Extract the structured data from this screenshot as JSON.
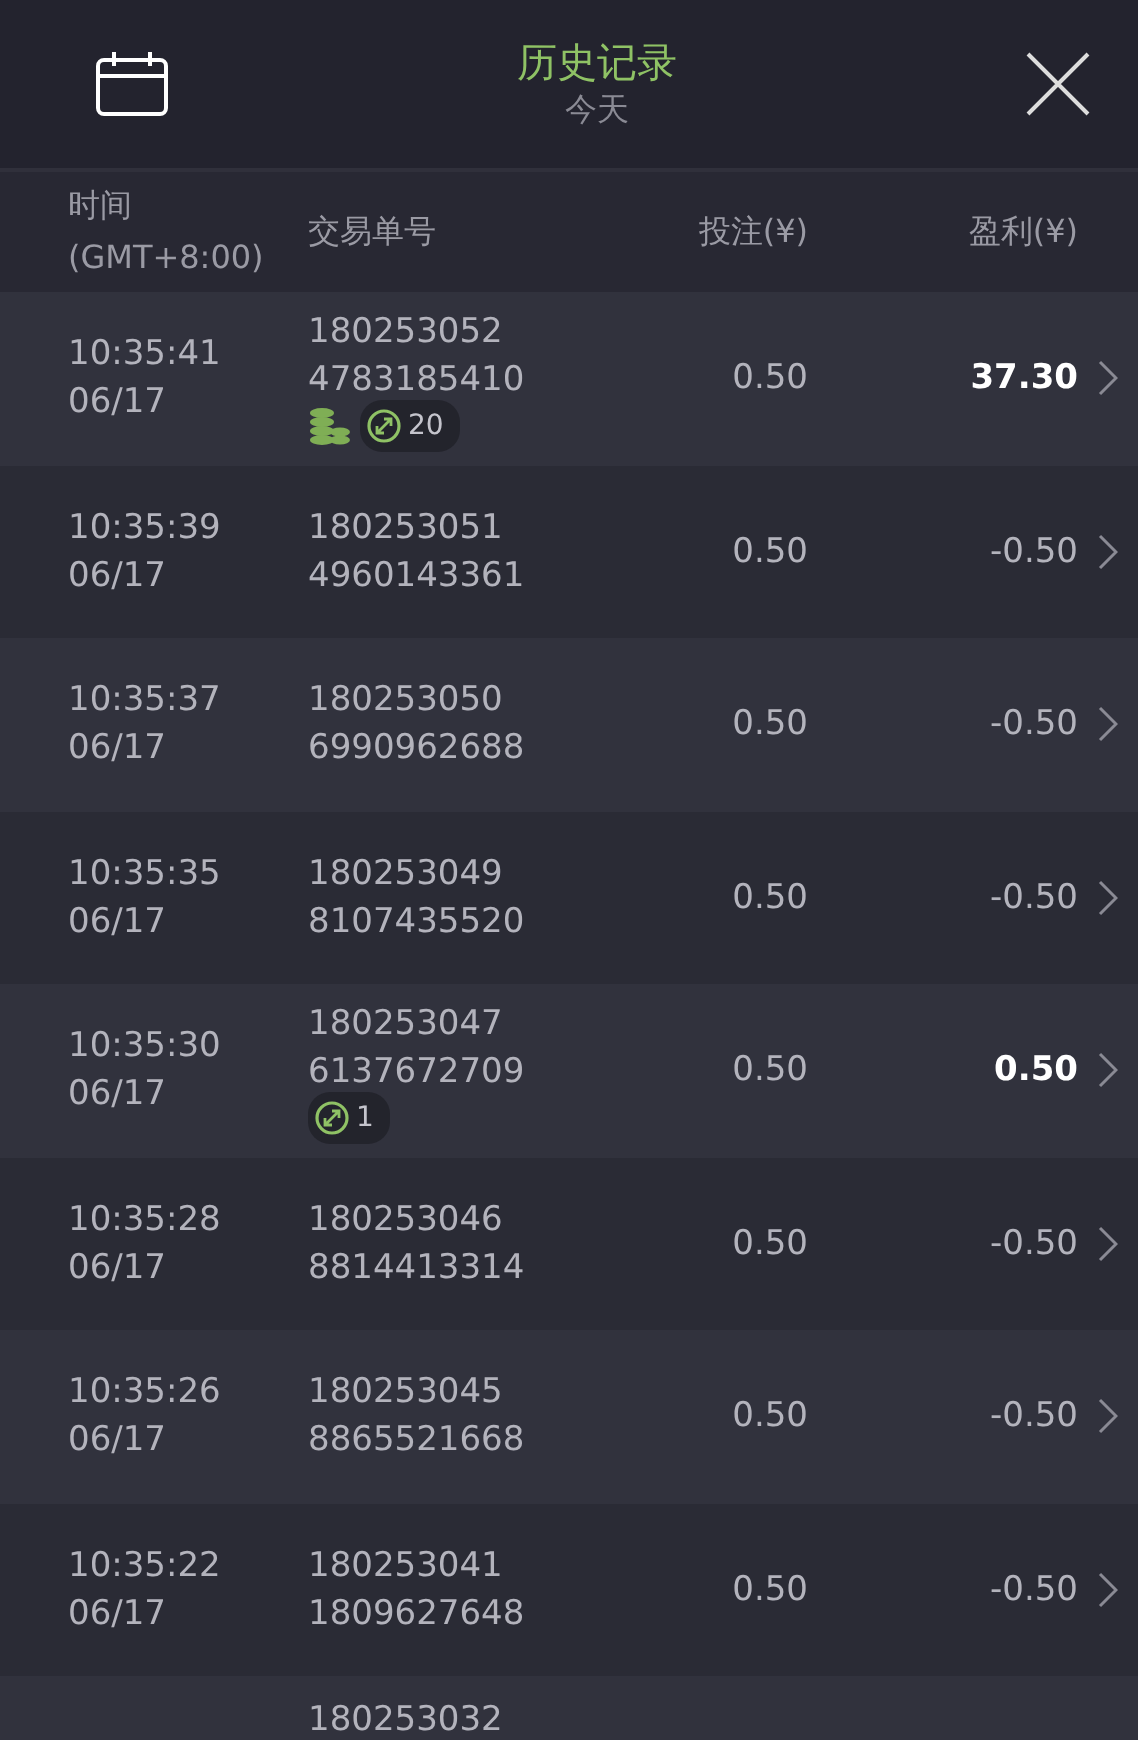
{
  "header": {
    "title": "历史记录",
    "subtitle": "今天"
  },
  "columns": [
    {
      "label": "时间\n(GMT+8:00)"
    },
    {
      "label": "交易单号"
    },
    {
      "label": "投注(¥)"
    },
    {
      "label": "盈利(¥)"
    }
  ],
  "rows": [
    {
      "time": "10:35:41",
      "date": "06/17",
      "order": [
        "180253052",
        "4783185410"
      ],
      "bet": "0.50",
      "profit": "37.30",
      "win": true,
      "coins": true,
      "spins": "20"
    },
    {
      "time": "10:35:39",
      "date": "06/17",
      "order": [
        "180253051",
        "4960143361"
      ],
      "bet": "0.50",
      "profit": "-0.50",
      "win": false,
      "coins": false
    },
    {
      "time": "10:35:37",
      "date": "06/17",
      "order": [
        "180253050",
        "6990962688"
      ],
      "bet": "0.50",
      "profit": "-0.50",
      "win": false,
      "coins": false
    },
    {
      "time": "10:35:35",
      "date": "06/17",
      "order": [
        "180253049",
        "8107435520"
      ],
      "bet": "0.50",
      "profit": "-0.50",
      "win": false,
      "coins": false
    },
    {
      "time": "10:35:30",
      "date": "06/17",
      "order": [
        "180253047",
        "6137672709"
      ],
      "bet": "0.50",
      "profit": "0.50",
      "win": true,
      "coins": false,
      "spins": "1"
    },
    {
      "time": "10:35:28",
      "date": "06/17",
      "order": [
        "180253046",
        "8814413314"
      ],
      "bet": "0.50",
      "profit": "-0.50",
      "win": false,
      "coins": false
    },
    {
      "time": "10:35:26",
      "date": "06/17",
      "order": [
        "180253045",
        "8865521668"
      ],
      "bet": "0.50",
      "profit": "-0.50",
      "win": false,
      "coins": false
    },
    {
      "time": "10:35:22",
      "date": "06/17",
      "order": [
        "180253041",
        "1809627648"
      ],
      "bet": "0.50",
      "profit": "-0.50",
      "win": false,
      "coins": false
    },
    {
      "order": [
        "180253032"
      ]
    }
  ]
}
